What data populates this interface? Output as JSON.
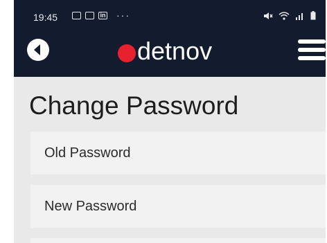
{
  "status_bar": {
    "time": "19:45",
    "left_icons": [
      "image-icon",
      "message-icon",
      "linkedin-icon"
    ],
    "more": "···",
    "right_icons": [
      "mute-icon",
      "wifi-icon",
      "signal-icon",
      "battery-icon"
    ]
  },
  "header": {
    "brand": "detnov",
    "brand_dot_color": "#e8212e",
    "background": "#131c2e"
  },
  "page": {
    "title": "Change Password"
  },
  "form": {
    "old_password_placeholder": "Old Password",
    "new_password_placeholder": "New Password"
  }
}
